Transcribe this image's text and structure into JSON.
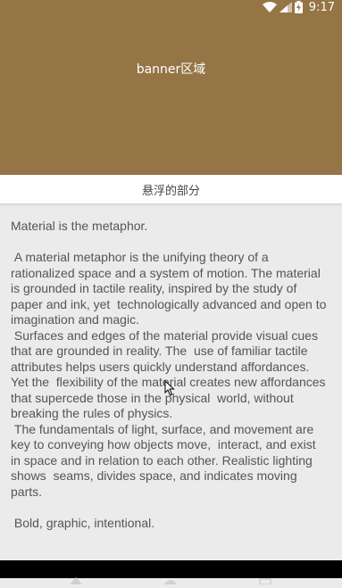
{
  "status_bar": {
    "time": "9:17",
    "icons": [
      "wifi-icon",
      "signal-icon",
      "battery-charging-icon"
    ]
  },
  "banner": {
    "title": "banner区域"
  },
  "floating_bar": {
    "label": "悬浮的部分"
  },
  "content": {
    "heading": "Material is the metaphor.",
    "p1": " A material metaphor is the unifying theory of a rationalized space and a system of motion. The material is grounded in tactile reality, inspired by the study of paper and ink, yet  technologically advanced and open to imagination and magic.",
    "p2": " Surfaces and edges of the material provide visual cues that are grounded in reality. The  use of familiar tactile attributes helps users quickly understand affordances. Yet the  flexibility of the material creates new affordances that supercede those in the physical  world, without breaking the rules of physics.",
    "p3": " The fundamentals of light, surface, and movement are key to conveying how objects move,  interact, and exist in space and in relation to each other. Realistic lighting shows  seams, divides space, and indicates moving parts.",
    "p4": " Bold, graphic, intentional."
  },
  "colors": {
    "banner": "#957546",
    "background": "#ebebeb",
    "floating_bar": "#ffffff",
    "text": "#555555"
  }
}
